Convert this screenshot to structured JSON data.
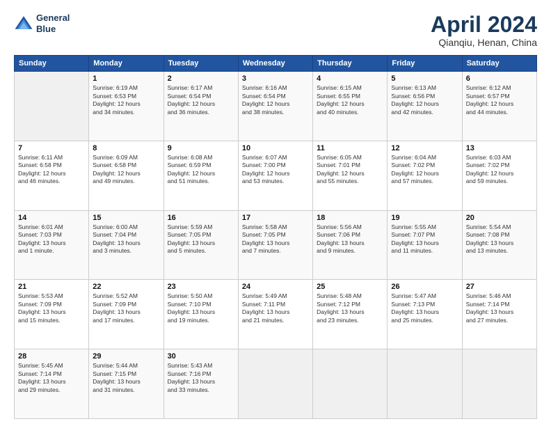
{
  "header": {
    "logo_line1": "General",
    "logo_line2": "Blue",
    "title": "April 2024",
    "subtitle": "Qianqiu, Henan, China"
  },
  "calendar": {
    "days_of_week": [
      "Sunday",
      "Monday",
      "Tuesday",
      "Wednesday",
      "Thursday",
      "Friday",
      "Saturday"
    ],
    "weeks": [
      [
        {
          "day": "",
          "info": ""
        },
        {
          "day": "1",
          "info": "Sunrise: 6:19 AM\nSunset: 6:53 PM\nDaylight: 12 hours\nand 34 minutes."
        },
        {
          "day": "2",
          "info": "Sunrise: 6:17 AM\nSunset: 6:54 PM\nDaylight: 12 hours\nand 36 minutes."
        },
        {
          "day": "3",
          "info": "Sunrise: 6:16 AM\nSunset: 6:54 PM\nDaylight: 12 hours\nand 38 minutes."
        },
        {
          "day": "4",
          "info": "Sunrise: 6:15 AM\nSunset: 6:55 PM\nDaylight: 12 hours\nand 40 minutes."
        },
        {
          "day": "5",
          "info": "Sunrise: 6:13 AM\nSunset: 6:56 PM\nDaylight: 12 hours\nand 42 minutes."
        },
        {
          "day": "6",
          "info": "Sunrise: 6:12 AM\nSunset: 6:57 PM\nDaylight: 12 hours\nand 44 minutes."
        }
      ],
      [
        {
          "day": "7",
          "info": "Sunrise: 6:11 AM\nSunset: 6:58 PM\nDaylight: 12 hours\nand 46 minutes."
        },
        {
          "day": "8",
          "info": "Sunrise: 6:09 AM\nSunset: 6:58 PM\nDaylight: 12 hours\nand 49 minutes."
        },
        {
          "day": "9",
          "info": "Sunrise: 6:08 AM\nSunset: 6:59 PM\nDaylight: 12 hours\nand 51 minutes."
        },
        {
          "day": "10",
          "info": "Sunrise: 6:07 AM\nSunset: 7:00 PM\nDaylight: 12 hours\nand 53 minutes."
        },
        {
          "day": "11",
          "info": "Sunrise: 6:05 AM\nSunset: 7:01 PM\nDaylight: 12 hours\nand 55 minutes."
        },
        {
          "day": "12",
          "info": "Sunrise: 6:04 AM\nSunset: 7:02 PM\nDaylight: 12 hours\nand 57 minutes."
        },
        {
          "day": "13",
          "info": "Sunrise: 6:03 AM\nSunset: 7:02 PM\nDaylight: 12 hours\nand 59 minutes."
        }
      ],
      [
        {
          "day": "14",
          "info": "Sunrise: 6:01 AM\nSunset: 7:03 PM\nDaylight: 13 hours\nand 1 minute."
        },
        {
          "day": "15",
          "info": "Sunrise: 6:00 AM\nSunset: 7:04 PM\nDaylight: 13 hours\nand 3 minutes."
        },
        {
          "day": "16",
          "info": "Sunrise: 5:59 AM\nSunset: 7:05 PM\nDaylight: 13 hours\nand 5 minutes."
        },
        {
          "day": "17",
          "info": "Sunrise: 5:58 AM\nSunset: 7:05 PM\nDaylight: 13 hours\nand 7 minutes."
        },
        {
          "day": "18",
          "info": "Sunrise: 5:56 AM\nSunset: 7:06 PM\nDaylight: 13 hours\nand 9 minutes."
        },
        {
          "day": "19",
          "info": "Sunrise: 5:55 AM\nSunset: 7:07 PM\nDaylight: 13 hours\nand 11 minutes."
        },
        {
          "day": "20",
          "info": "Sunrise: 5:54 AM\nSunset: 7:08 PM\nDaylight: 13 hours\nand 13 minutes."
        }
      ],
      [
        {
          "day": "21",
          "info": "Sunrise: 5:53 AM\nSunset: 7:09 PM\nDaylight: 13 hours\nand 15 minutes."
        },
        {
          "day": "22",
          "info": "Sunrise: 5:52 AM\nSunset: 7:09 PM\nDaylight: 13 hours\nand 17 minutes."
        },
        {
          "day": "23",
          "info": "Sunrise: 5:50 AM\nSunset: 7:10 PM\nDaylight: 13 hours\nand 19 minutes."
        },
        {
          "day": "24",
          "info": "Sunrise: 5:49 AM\nSunset: 7:11 PM\nDaylight: 13 hours\nand 21 minutes."
        },
        {
          "day": "25",
          "info": "Sunrise: 5:48 AM\nSunset: 7:12 PM\nDaylight: 13 hours\nand 23 minutes."
        },
        {
          "day": "26",
          "info": "Sunrise: 5:47 AM\nSunset: 7:13 PM\nDaylight: 13 hours\nand 25 minutes."
        },
        {
          "day": "27",
          "info": "Sunrise: 5:46 AM\nSunset: 7:14 PM\nDaylight: 13 hours\nand 27 minutes."
        }
      ],
      [
        {
          "day": "28",
          "info": "Sunrise: 5:45 AM\nSunset: 7:14 PM\nDaylight: 13 hours\nand 29 minutes."
        },
        {
          "day": "29",
          "info": "Sunrise: 5:44 AM\nSunset: 7:15 PM\nDaylight: 13 hours\nand 31 minutes."
        },
        {
          "day": "30",
          "info": "Sunrise: 5:43 AM\nSunset: 7:16 PM\nDaylight: 13 hours\nand 33 minutes."
        },
        {
          "day": "",
          "info": ""
        },
        {
          "day": "",
          "info": ""
        },
        {
          "day": "",
          "info": ""
        },
        {
          "day": "",
          "info": ""
        }
      ]
    ]
  }
}
